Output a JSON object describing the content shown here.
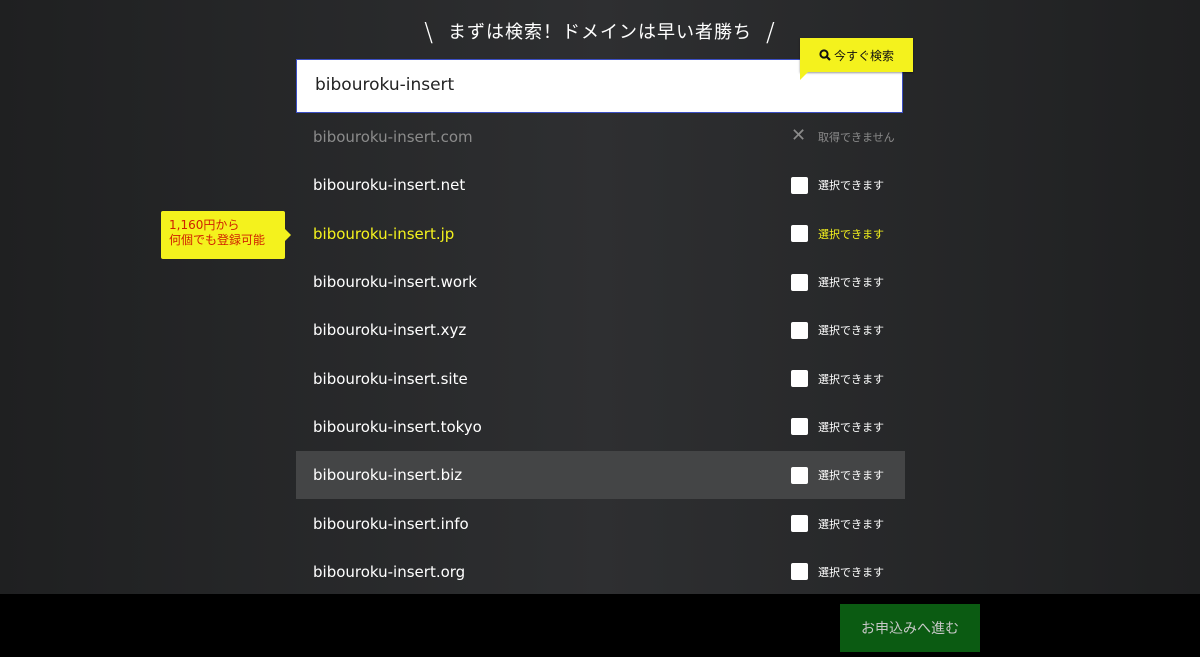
{
  "headline": "まずは検索！ドメインは早い者勝ち",
  "search": {
    "value": "bibouroku-insert",
    "button_label": "今すぐ検索"
  },
  "promo": {
    "line1": "1,160円から",
    "line2": "何個でも登録可能"
  },
  "domains": [
    {
      "name": "bibouroku-insert.com",
      "status": "取得できません",
      "available": false
    },
    {
      "name": "bibouroku-insert.net",
      "status": "選択できます",
      "available": true
    },
    {
      "name": "bibouroku-insert.jp",
      "status": "選択できます",
      "available": true
    },
    {
      "name": "bibouroku-insert.work",
      "status": "選択できます",
      "available": true
    },
    {
      "name": "bibouroku-insert.xyz",
      "status": "選択できます",
      "available": true
    },
    {
      "name": "bibouroku-insert.site",
      "status": "選択できます",
      "available": true
    },
    {
      "name": "bibouroku-insert.tokyo",
      "status": "選択できます",
      "available": true
    },
    {
      "name": "bibouroku-insert.biz",
      "status": "選択できます",
      "available": true
    },
    {
      "name": "bibouroku-insert.info",
      "status": "選択できます",
      "available": true
    },
    {
      "name": "bibouroku-insert.org",
      "status": "選択できます",
      "available": true
    }
  ],
  "footer": {
    "proceed_label": "お申込みへ進む"
  },
  "colors": {
    "accent_yellow": "#f4f21d",
    "promo_text": "#d02000",
    "proceed_bg": "#0b5b12"
  }
}
